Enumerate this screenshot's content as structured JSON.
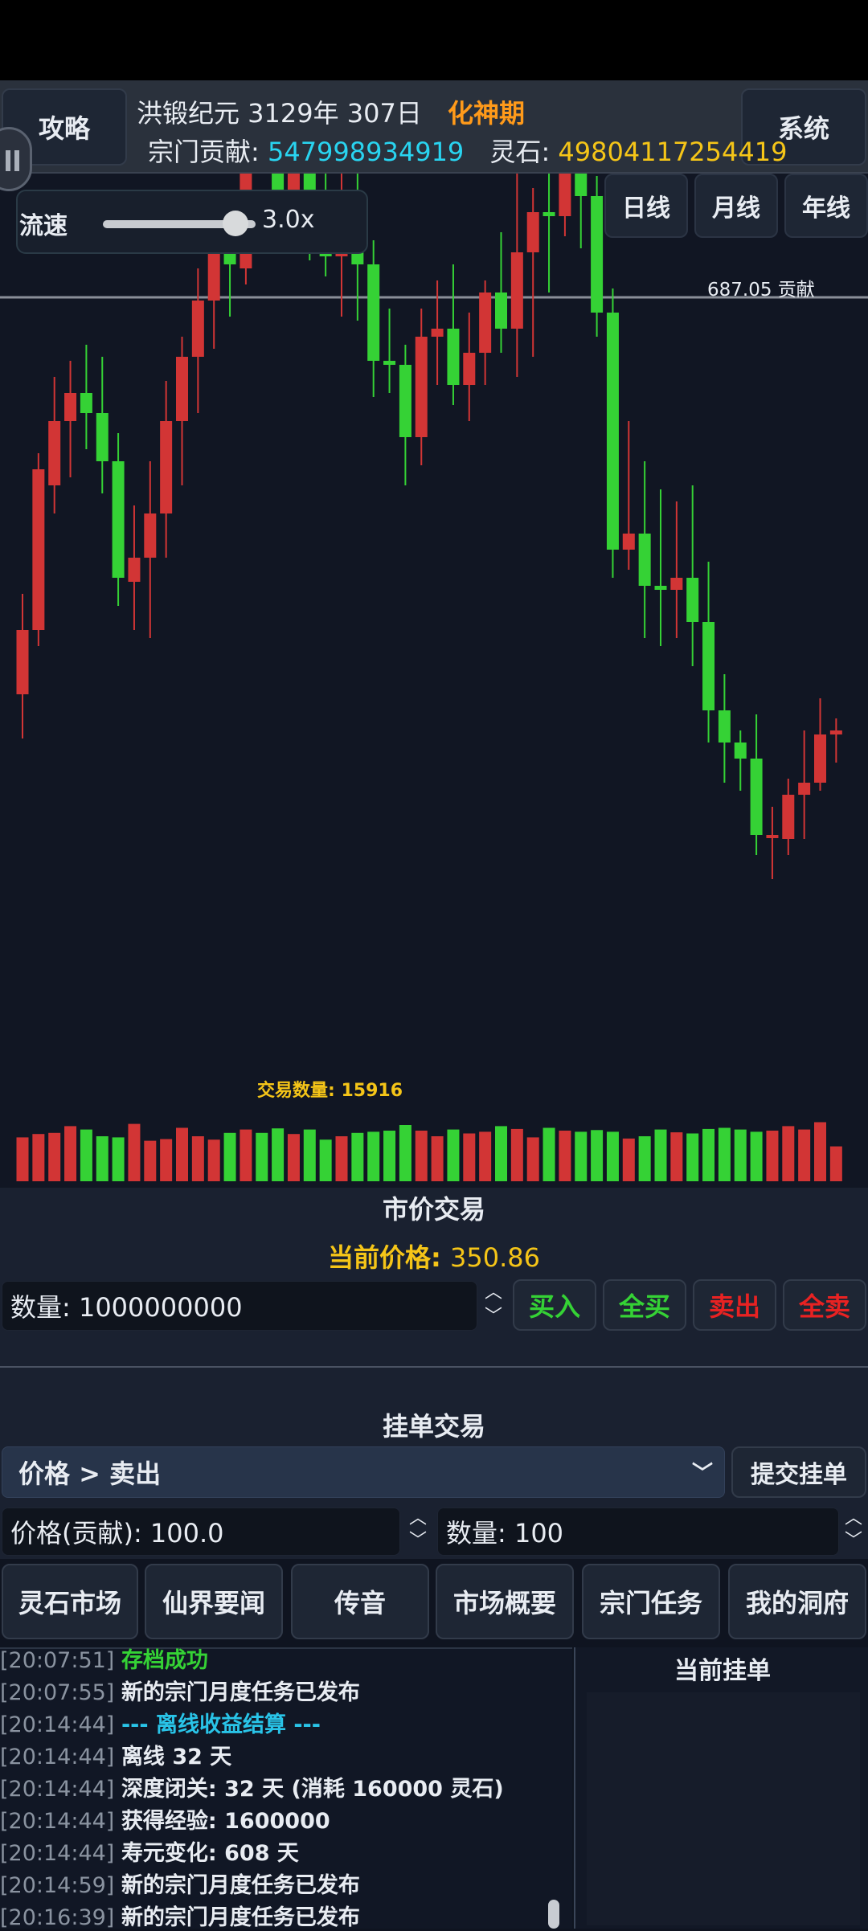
{
  "header": {
    "left_button": "攻略",
    "right_button": "系统",
    "date_text": "洪锻纪元 3129年 307日",
    "realm": "化神期",
    "contribution_label": "宗门贡献:",
    "contribution_value": "547998934919",
    "spirit_stone_label": "灵石:",
    "spirit_stone_value": "49804117254419"
  },
  "speed": {
    "label": "流速",
    "value": "3.0x",
    "level_fraction": 0.87
  },
  "timeframes": [
    "日线",
    "月线",
    "年线"
  ],
  "chart_data": {
    "type": "candlestick",
    "reference_line_label": "687.05 贡献",
    "volume_label": "交易数量: 15916",
    "candles": [
      {
        "o": 530,
        "c": 610,
        "h": 655,
        "l": 475,
        "v": 0.78
      },
      {
        "o": 610,
        "c": 810,
        "h": 830,
        "l": 590,
        "v": 0.84
      },
      {
        "o": 790,
        "c": 870,
        "h": 925,
        "l": 755,
        "v": 0.86
      },
      {
        "o": 870,
        "c": 905,
        "h": 945,
        "l": 800,
        "v": 0.98
      },
      {
        "o": 905,
        "c": 880,
        "h": 965,
        "l": 835,
        "v": 0.92
      },
      {
        "o": 880,
        "c": 820,
        "h": 950,
        "l": 780,
        "v": 0.8
      },
      {
        "o": 820,
        "c": 675,
        "h": 855,
        "l": 640,
        "v": 0.78
      },
      {
        "o": 670,
        "c": 700,
        "h": 765,
        "l": 610,
        "v": 1.02
      },
      {
        "o": 700,
        "c": 755,
        "h": 820,
        "l": 600,
        "v": 0.72
      },
      {
        "o": 755,
        "c": 870,
        "h": 920,
        "l": 700,
        "v": 0.75
      },
      {
        "o": 870,
        "c": 950,
        "h": 975,
        "l": 790,
        "v": 0.95
      },
      {
        "o": 950,
        "c": 1020,
        "h": 1060,
        "l": 880,
        "v": 0.8
      },
      {
        "o": 1020,
        "c": 1080,
        "h": 1115,
        "l": 960,
        "v": 0.74
      },
      {
        "o": 1080,
        "c": 1065,
        "h": 1140,
        "l": 1000,
        "v": 0.86
      },
      {
        "o": 1060,
        "c": 1295,
        "h": 1335,
        "l": 1040,
        "v": 0.92
      },
      {
        "o": 1305,
        "c": 1255,
        "h": 1335,
        "l": 1200,
        "v": 0.86
      },
      {
        "o": 1255,
        "c": 1140,
        "h": 1310,
        "l": 1090,
        "v": 0.94
      },
      {
        "o": 1140,
        "c": 1265,
        "h": 1310,
        "l": 1080,
        "v": 0.84
      },
      {
        "o": 1255,
        "c": 1135,
        "h": 1335,
        "l": 1070,
        "v": 0.92
      },
      {
        "o": 1135,
        "c": 1075,
        "h": 1215,
        "l": 1050,
        "v": 0.74
      },
      {
        "o": 1075,
        "c": 1145,
        "h": 1185,
        "l": 1000,
        "v": 0.8
      },
      {
        "o": 1140,
        "c": 1065,
        "h": 1195,
        "l": 995,
        "v": 0.86
      },
      {
        "o": 1065,
        "c": 945,
        "h": 1095,
        "l": 900,
        "v": 0.88
      },
      {
        "o": 945,
        "c": 940,
        "h": 1010,
        "l": 905,
        "v": 0.9
      },
      {
        "o": 940,
        "c": 850,
        "h": 965,
        "l": 790,
        "v": 1.0
      },
      {
        "o": 850,
        "c": 975,
        "h": 1010,
        "l": 815,
        "v": 0.9
      },
      {
        "o": 975,
        "c": 985,
        "h": 1045,
        "l": 915,
        "v": 0.8
      },
      {
        "o": 985,
        "c": 915,
        "h": 1065,
        "l": 890,
        "v": 0.92
      },
      {
        "o": 915,
        "c": 955,
        "h": 1005,
        "l": 870,
        "v": 0.85
      },
      {
        "o": 955,
        "c": 1030,
        "h": 1045,
        "l": 915,
        "v": 0.88
      },
      {
        "o": 1030,
        "c": 985,
        "h": 1105,
        "l": 955,
        "v": 0.98
      },
      {
        "o": 985,
        "c": 1080,
        "h": 1210,
        "l": 925,
        "v": 0.93
      },
      {
        "o": 1080,
        "c": 1130,
        "h": 1160,
        "l": 950,
        "v": 0.78
      },
      {
        "o": 1130,
        "c": 1125,
        "h": 1240,
        "l": 1030,
        "v": 0.95
      },
      {
        "o": 1125,
        "c": 1180,
        "h": 1335,
        "l": 1100,
        "v": 0.9
      },
      {
        "o": 1180,
        "c": 1150,
        "h": 1215,
        "l": 1085,
        "v": 0.88
      },
      {
        "o": 1150,
        "c": 1005,
        "h": 1175,
        "l": 975,
        "v": 0.91
      },
      {
        "o": 1005,
        "c": 710,
        "h": 1035,
        "l": 675,
        "v": 0.88
      },
      {
        "o": 710,
        "c": 730,
        "h": 870,
        "l": 685,
        "v": 0.76
      },
      {
        "o": 730,
        "c": 665,
        "h": 820,
        "l": 600,
        "v": 0.8
      },
      {
        "o": 665,
        "c": 660,
        "h": 785,
        "l": 590,
        "v": 0.92
      },
      {
        "o": 660,
        "c": 675,
        "h": 770,
        "l": 600,
        "v": 0.87
      },
      {
        "o": 675,
        "c": 620,
        "h": 790,
        "l": 565,
        "v": 0.85
      },
      {
        "o": 620,
        "c": 510,
        "h": 695,
        "l": 470,
        "v": 0.93
      },
      {
        "o": 510,
        "c": 470,
        "h": 555,
        "l": 420,
        "v": 0.95
      },
      {
        "o": 470,
        "c": 450,
        "h": 485,
        "l": 410,
        "v": 0.92
      },
      {
        "o": 450,
        "c": 355,
        "h": 505,
        "l": 330,
        "v": 0.88
      },
      {
        "o": 355,
        "c": 355,
        "h": 390,
        "l": 300,
        "v": 0.9
      },
      {
        "o": 350,
        "c": 405,
        "h": 425,
        "l": 330,
        "v": 0.98
      },
      {
        "o": 405,
        "c": 420,
        "h": 485,
        "l": 350,
        "v": 0.92
      },
      {
        "o": 420,
        "c": 480,
        "h": 525,
        "l": 410,
        "v": 1.05
      },
      {
        "o": 480,
        "c": 485,
        "h": 500,
        "l": 445,
        "v": 0.62
      }
    ]
  },
  "market": {
    "title": "市价交易",
    "current_price_label": "当前价格:",
    "current_price_value": "350.86",
    "quantity_input": "数量: 1000000000",
    "buttons": {
      "buy": "买入",
      "buy_all": "全买",
      "sell": "卖出",
      "sell_all": "全卖"
    }
  },
  "pending": {
    "title": "挂单交易",
    "select_value": "价格 > 卖出",
    "submit": "提交挂单",
    "price_input": "价格(贡献): 100.0",
    "quantity_input": "数量: 100"
  },
  "nav": [
    "灵石市场",
    "仙界要闻",
    "传音",
    "市场概要",
    "宗门任务",
    "我的洞府"
  ],
  "log": [
    {
      "ts": "[20:07:51]",
      "msg": "存档成功",
      "color": "#35d235"
    },
    {
      "ts": "[20:07:55]",
      "msg": "新的宗门月度任务已发布",
      "color": "#e8ecf2"
    },
    {
      "ts": "[20:14:44]",
      "msg": "--- 离线收益结算 ---",
      "color": "#29c4e8"
    },
    {
      "ts": "[20:14:44]",
      "msg": "离线 32 天",
      "color": "#e8ecf2"
    },
    {
      "ts": "[20:14:44]",
      "msg": "深度闭关: 32 天 (消耗 160000 灵石)",
      "color": "#e8ecf2"
    },
    {
      "ts": "[20:14:44]",
      "msg": "获得经验: 1600000",
      "color": "#e8ecf2"
    },
    {
      "ts": "[20:14:44]",
      "msg": "寿元变化: 608 天",
      "color": "#e8ecf2"
    },
    {
      "ts": "[20:14:59]",
      "msg": "新的宗门月度任务已发布",
      "color": "#e8ecf2"
    },
    {
      "ts": "[20:16:39]",
      "msg": "新的宗门月度任务已发布",
      "color": "#e8ecf2"
    }
  ],
  "orders": {
    "title": "当前挂单"
  },
  "colors": {
    "up": "#d23535",
    "down": "#35d235",
    "accent_orange": "#ff9a1a",
    "accent_cyan": "#29d4f0",
    "accent_yellow": "#f5c518"
  }
}
